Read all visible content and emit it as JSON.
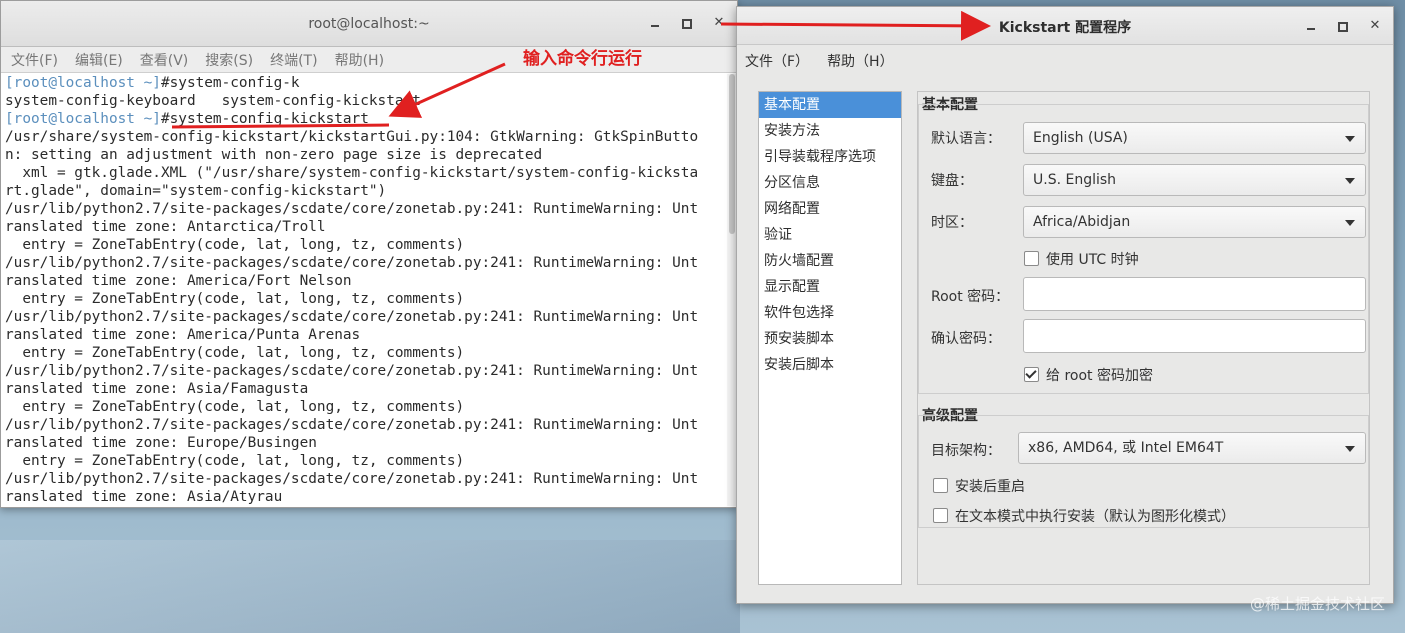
{
  "terminal": {
    "title": "root@localhost:~",
    "menu": [
      "文件(F)",
      "编辑(E)",
      "查看(V)",
      "搜索(S)",
      "终端(T)",
      "帮助(H)"
    ],
    "lines": [
      {
        "user": "[root@localhost ~]",
        "text": "#system-config-k"
      },
      {
        "user": "",
        "text": "system-config-keyboard   system-config-kickstart"
      },
      {
        "user": "[root@localhost ~]",
        "text": "#system-config-kickstart"
      },
      {
        "user": "",
        "text": "/usr/share/system-config-kickstart/kickstartGui.py:104: GtkWarning: GtkSpinButto"
      },
      {
        "user": "",
        "text": "n: setting an adjustment with non-zero page size is deprecated"
      },
      {
        "user": "",
        "text": "  xml = gtk.glade.XML (\"/usr/share/system-config-kickstart/system-config-kicksta"
      },
      {
        "user": "",
        "text": "rt.glade\", domain=\"system-config-kickstart\")"
      },
      {
        "user": "",
        "text": "/usr/lib/python2.7/site-packages/scdate/core/zonetab.py:241: RuntimeWarning: Unt"
      },
      {
        "user": "",
        "text": "ranslated time zone: Antarctica/Troll"
      },
      {
        "user": "",
        "text": "  entry = ZoneTabEntry(code, lat, long, tz, comments)"
      },
      {
        "user": "",
        "text": "/usr/lib/python2.7/site-packages/scdate/core/zonetab.py:241: RuntimeWarning: Unt"
      },
      {
        "user": "",
        "text": "ranslated time zone: America/Fort Nelson"
      },
      {
        "user": "",
        "text": "  entry = ZoneTabEntry(code, lat, long, tz, comments)"
      },
      {
        "user": "",
        "text": "/usr/lib/python2.7/site-packages/scdate/core/zonetab.py:241: RuntimeWarning: Unt"
      },
      {
        "user": "",
        "text": "ranslated time zone: America/Punta Arenas"
      },
      {
        "user": "",
        "text": "  entry = ZoneTabEntry(code, lat, long, tz, comments)"
      },
      {
        "user": "",
        "text": "/usr/lib/python2.7/site-packages/scdate/core/zonetab.py:241: RuntimeWarning: Unt"
      },
      {
        "user": "",
        "text": "ranslated time zone: Asia/Famagusta"
      },
      {
        "user": "",
        "text": "  entry = ZoneTabEntry(code, lat, long, tz, comments)"
      },
      {
        "user": "",
        "text": "/usr/lib/python2.7/site-packages/scdate/core/zonetab.py:241: RuntimeWarning: Unt"
      },
      {
        "user": "",
        "text": "ranslated time zone: Europe/Busingen"
      },
      {
        "user": "",
        "text": "  entry = ZoneTabEntry(code, lat, long, tz, comments)"
      },
      {
        "user": "",
        "text": "/usr/lib/python2.7/site-packages/scdate/core/zonetab.py:241: RuntimeWarning: Unt"
      },
      {
        "user": "",
        "text": "ranslated time zone: Asia/Atyrau"
      }
    ]
  },
  "annotation": {
    "text": "输入命令行运行",
    "color": "#e02020"
  },
  "kickstart": {
    "title": "Kickstart 配置程序",
    "menu": [
      "文件（F）",
      "帮助（H）"
    ],
    "sidebar": [
      "基本配置",
      "安装方法",
      "引导装载程序选项",
      "分区信息",
      "网络配置",
      "验证",
      "防火墙配置",
      "显示配置",
      "软件包选择",
      "预安装脚本",
      "安装后脚本"
    ],
    "sidebar_active": 0,
    "basic": {
      "title": "基本配置",
      "language_label": "默认语言：",
      "language_value": "English (USA)",
      "keyboard_label": "键盘：",
      "keyboard_value": "U.S. English",
      "timezone_label": "时区：",
      "timezone_value": "Africa/Abidjan",
      "utc_label": "使用  UTC 时钟",
      "utc_checked": false,
      "root_pw_label": "Root 密码：",
      "confirm_pw_label": "确认密码：",
      "encrypt_label": "给  root 密码加密",
      "encrypt_checked": true
    },
    "advanced": {
      "title": "高级配置",
      "arch_label": "目标架构：",
      "arch_value": "x86, AMD64, 或  Intel EM64T",
      "reboot_label": "安装后重启",
      "reboot_checked": false,
      "textmode_label": "在文本模式中执行安装（默认为图形化模式）",
      "textmode_checked": false
    }
  },
  "watermark": "@稀土掘金技术社区"
}
